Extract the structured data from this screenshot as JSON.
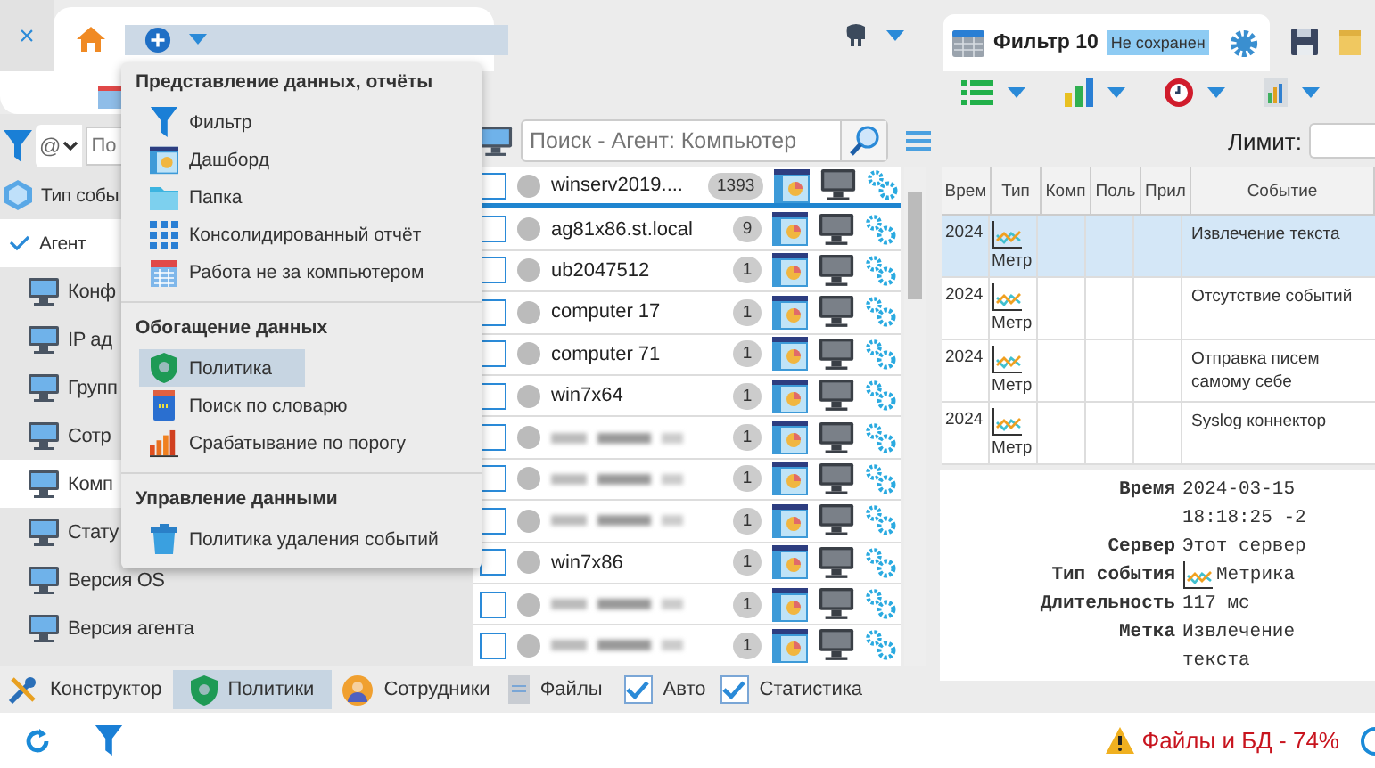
{
  "top_bar": {
    "close_tab": "×"
  },
  "left_panel": {
    "search": {
      "select_value": "@",
      "placeholder": "По"
    },
    "items": [
      {
        "label": "Тип собы",
        "checked": false
      },
      {
        "label": "Агент",
        "checked": true,
        "children": [
          {
            "label": "Конф",
            "selected": false
          },
          {
            "label": "IP ад",
            "selected": false
          },
          {
            "label": "Групп",
            "selected": false
          },
          {
            "label": "Сотр",
            "selected": false
          },
          {
            "label": "Комп",
            "selected": true
          },
          {
            "label": "Стату",
            "selected": false
          },
          {
            "label": "Версия OS",
            "selected": false
          },
          {
            "label": "Версия агента",
            "selected": false
          }
        ]
      }
    ]
  },
  "menu": {
    "sections": [
      {
        "title": "Представление данных, отчёты",
        "items": [
          {
            "kind": "filter",
            "label": "Фильтр",
            "selected": false
          },
          {
            "kind": "dashboard",
            "label": "Дашборд",
            "selected": false
          },
          {
            "kind": "folder",
            "label": "Папка",
            "selected": false
          },
          {
            "kind": "grid",
            "label": "Консолидированный отчёт",
            "selected": false
          },
          {
            "kind": "calendar",
            "label": "Работа не за компьютером",
            "selected": false
          }
        ]
      },
      {
        "title": "Обогащение данных",
        "items": [
          {
            "kind": "shield",
            "label": "Политика",
            "selected": true
          },
          {
            "kind": "book",
            "label": "Поиск по словарю",
            "selected": false
          },
          {
            "kind": "bars",
            "label": "Срабатывание по порогу",
            "selected": false
          }
        ]
      },
      {
        "title": "Управление данными",
        "items": [
          {
            "kind": "trash",
            "label": "Политика удаления событий",
            "selected": false
          }
        ]
      }
    ]
  },
  "agent_list": {
    "search": {
      "placeholder": "Поиск - Агент: Компьютер"
    },
    "rows": [
      {
        "kind": "named",
        "name": "winserv2019....",
        "count": "1393",
        "selected": true
      },
      {
        "kind": "named",
        "name": "ag81x86.st.local",
        "count": "9",
        "selected": false
      },
      {
        "kind": "named",
        "name": "ub2047512",
        "count": "1",
        "selected": false
      },
      {
        "kind": "named",
        "name": "computer 17",
        "count": "1",
        "selected": false
      },
      {
        "kind": "named",
        "name": "computer 71",
        "count": "1",
        "selected": false
      },
      {
        "kind": "named",
        "name": "win7x64",
        "count": "1",
        "selected": false
      },
      {
        "kind": "blurred",
        "count": "1",
        "selected": false
      },
      {
        "kind": "blurred",
        "count": "1",
        "selected": false
      },
      {
        "kind": "blurred",
        "count": "1",
        "selected": false
      },
      {
        "kind": "named",
        "name": "win7x86",
        "count": "1",
        "selected": false
      },
      {
        "kind": "blurred",
        "count": "1",
        "selected": false
      },
      {
        "kind": "blurred",
        "count": "1",
        "selected": false
      }
    ]
  },
  "filter_tab": {
    "title": "Фильтр 10",
    "badge": "Не сохранен"
  },
  "limit": {
    "label": "Лимит:"
  },
  "events_table": {
    "columns": [
      "Врем",
      "Тип",
      "Комп",
      "Поль",
      "Прил",
      "Событие"
    ],
    "rows": [
      {
        "time": "2024",
        "type": "Метр",
        "event": "Извлечение текста",
        "selected": true
      },
      {
        "time": "2024",
        "type": "Метр",
        "event": "Отсутствие событий",
        "selected": false
      },
      {
        "time": "2024",
        "type": "Метр",
        "event": "Отправка писем самому себе",
        "selected": false
      },
      {
        "time": "2024",
        "type": "Метр",
        "event": "Syslog коннектор",
        "selected": false
      }
    ]
  },
  "details": [
    {
      "kind": "text",
      "label": "Время",
      "values": [
        "2024-03-15",
        "18:18:25 -2"
      ]
    },
    {
      "kind": "text",
      "label": "Сервер",
      "values": [
        "Этот сервер"
      ]
    },
    {
      "kind": "metric",
      "label": "Тип события",
      "values": [
        "Метрика"
      ]
    },
    {
      "kind": "text",
      "label": "Длительность",
      "values": [
        "117 мс"
      ]
    },
    {
      "kind": "text",
      "label": "Метка",
      "values": [
        "Извлечение",
        "текста"
      ]
    }
  ],
  "bottom_tabs": [
    {
      "kind": "tools",
      "label": "Конструктор",
      "selected": false
    },
    {
      "kind": "shield",
      "label": "Политики",
      "selected": true
    },
    {
      "kind": "person",
      "label": "Сотрудники",
      "selected": false
    },
    {
      "kind": "file",
      "label": "Файлы",
      "selected": false
    }
  ],
  "options": [
    {
      "label": "Авто",
      "checked": true
    },
    {
      "label": "Статистика",
      "checked": true
    }
  ],
  "status_bar": {
    "warning": "Файлы и БД - 74%"
  }
}
